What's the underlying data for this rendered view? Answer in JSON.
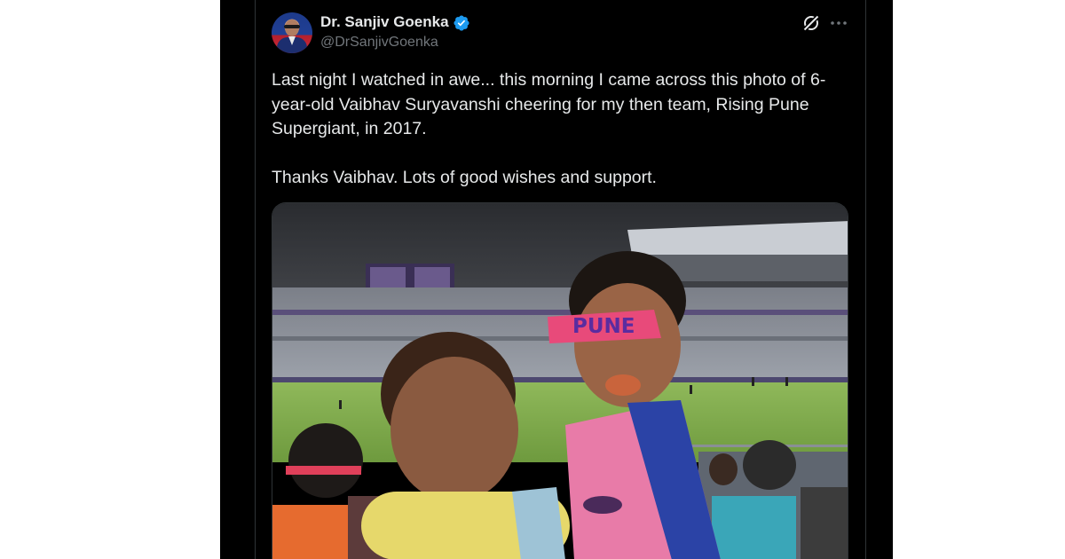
{
  "tweet": {
    "author": {
      "display_name": "Dr. Sanjiv Goenka",
      "handle": "@DrSanjivGoenka",
      "verified": true
    },
    "paragraphs": [
      "Last night I watched in awe... this morning I came across this photo of 6-year-old Vaibhav Suryavanshi cheering for my then team, Rising Pune Supergiant, in 2017.",
      "Thanks Vaibhav. Lots of good wishes and support."
    ],
    "media": {
      "headband_text": "PUNE"
    }
  },
  "icons": {
    "verified": "verified-badge-icon",
    "grok": "grok-icon",
    "more": "more-dots-icon"
  },
  "colors": {
    "background": "#000000",
    "text_primary": "#e7e9ea",
    "text_secondary": "#71767b",
    "verified_blue": "#1d9bf0",
    "border": "#2f3336"
  }
}
